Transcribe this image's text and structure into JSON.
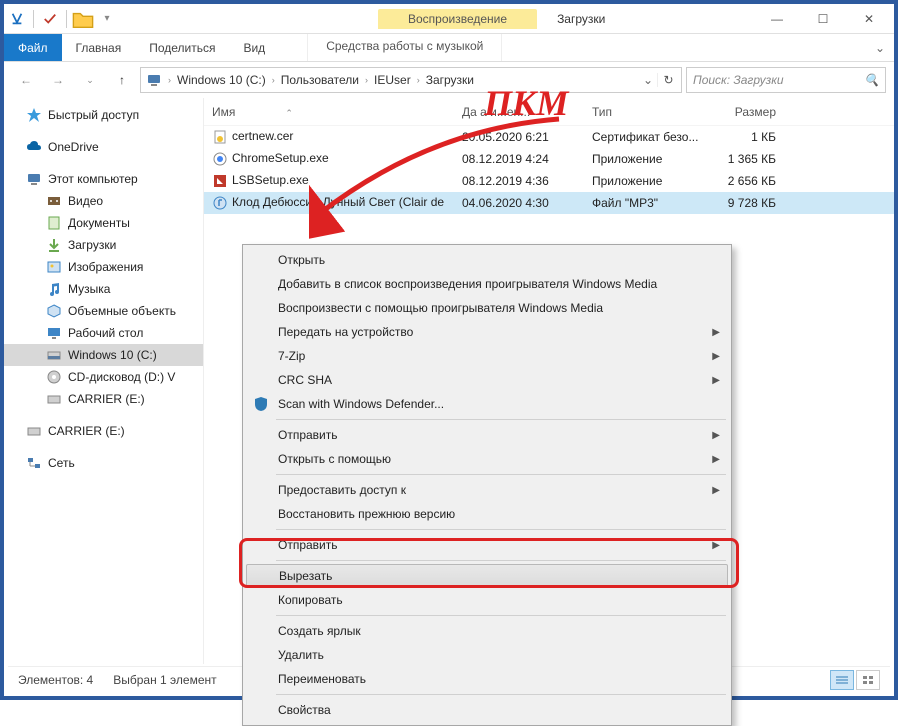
{
  "window": {
    "context_tab": "Воспроизведение",
    "title": "Загрузки",
    "min": "—",
    "max": "☐",
    "close": "✕"
  },
  "ribbon": {
    "file": "Файл",
    "tabs": [
      "Главная",
      "Поделиться",
      "Вид"
    ],
    "context_tool": "Средства работы с музыкой"
  },
  "address": {
    "back": "←",
    "fwd": "→",
    "up": "↑",
    "crumbs": [
      "Windows 10 (C:)",
      "Пользователи",
      "IEUser",
      "Загрузки"
    ],
    "search_placeholder": "Поиск: Загрузки"
  },
  "tree": [
    {
      "icon": "star",
      "label": "Быстрый доступ",
      "color": "#3a9bdc"
    },
    {
      "gap": true
    },
    {
      "icon": "cloud",
      "label": "OneDrive",
      "color": "#0a64a4"
    },
    {
      "gap": true
    },
    {
      "icon": "pc",
      "label": "Этот компьютер",
      "color": "#2e7bb5"
    },
    {
      "icon": "video",
      "label": "Видео",
      "indent": true,
      "color": "#7a5d3b"
    },
    {
      "icon": "doc",
      "label": "Документы",
      "indent": true,
      "color": "#6aa84f"
    },
    {
      "icon": "down",
      "label": "Загрузки",
      "indent": true,
      "color": "#6aa84f"
    },
    {
      "icon": "img",
      "label": "Изображения",
      "indent": true,
      "color": "#3d85c6"
    },
    {
      "icon": "music",
      "label": "Музыка",
      "indent": true,
      "color": "#3d85c6"
    },
    {
      "icon": "cube",
      "label": "Объемные объекть",
      "indent": true,
      "color": "#3d85c6"
    },
    {
      "icon": "desk",
      "label": "Рабочий стол",
      "indent": true,
      "color": "#3d85c6"
    },
    {
      "icon": "disk",
      "label": "Windows 10 (C:)",
      "indent": true,
      "selected": true,
      "color": "#5b7ca0"
    },
    {
      "icon": "cd",
      "label": "CD-дисковод (D:) V",
      "indent": true,
      "color": "#c7a645"
    },
    {
      "icon": "usb",
      "label": "CARRIER (E:)",
      "indent": true,
      "color": "#888"
    },
    {
      "gap": true
    },
    {
      "icon": "usb",
      "label": "CARRIER (E:)",
      "color": "#888"
    },
    {
      "gap": true
    },
    {
      "icon": "net",
      "label": "Сеть",
      "color": "#2e7bb5"
    }
  ],
  "columns": {
    "name": "Имя",
    "date": "Да а и...ен...",
    "type": "Тип",
    "size": "Размер"
  },
  "rows": [
    {
      "icon": "cert",
      "name": "certnew.cer",
      "date": "20.05.2020 6:21",
      "type": "Сертификат безо...",
      "size": "1 КБ"
    },
    {
      "icon": "chrome",
      "name": "ChromeSetup.exe",
      "date": "08.12.2019 4:24",
      "type": "Приложение",
      "size": "1 365 КБ"
    },
    {
      "icon": "lsb",
      "name": "LSBSetup.exe",
      "date": "08.12.2019 4:36",
      "type": "Приложение",
      "size": "2 656 КБ"
    },
    {
      "icon": "mp3",
      "name": "Клод Дебюсси - Лунный Свет (Clair de",
      "date": "04.06.2020 4:30",
      "type": "Файл \"MP3\"",
      "size": "9 728 КБ",
      "selected": true
    }
  ],
  "context_menu": [
    {
      "label": "Открыть"
    },
    {
      "label": "Добавить в список воспроизведения проигрывателя Windows Media"
    },
    {
      "label": "Воспроизвести с помощью проигрывателя Windows Media"
    },
    {
      "label": "Передать на устройство",
      "sub": true
    },
    {
      "label": "7-Zip",
      "sub": true
    },
    {
      "label": "CRC SHA",
      "sub": true
    },
    {
      "label": "Scan with Windows Defender...",
      "icon": "shield"
    },
    {
      "sep": true
    },
    {
      "label": "Отправить",
      "sub": true
    },
    {
      "label": "Открыть с помощью",
      "sub": true
    },
    {
      "sep": true
    },
    {
      "label": "Предоставить доступ к",
      "sub": true
    },
    {
      "label": "Восстановить прежнюю версию"
    },
    {
      "sep": true
    },
    {
      "label": "Отправить",
      "sub": true
    },
    {
      "sep": true
    },
    {
      "label": "Вырезать",
      "highlight": true
    },
    {
      "label": "Копировать"
    },
    {
      "sep": true
    },
    {
      "label": "Создать ярлык"
    },
    {
      "label": "Удалить"
    },
    {
      "label": "Переименовать"
    },
    {
      "sep": true
    },
    {
      "label": "Свойства"
    }
  ],
  "status": {
    "count": "Элементов: 4",
    "sel": "Выбран 1 элемент"
  },
  "annot": {
    "text": "ПКМ"
  }
}
